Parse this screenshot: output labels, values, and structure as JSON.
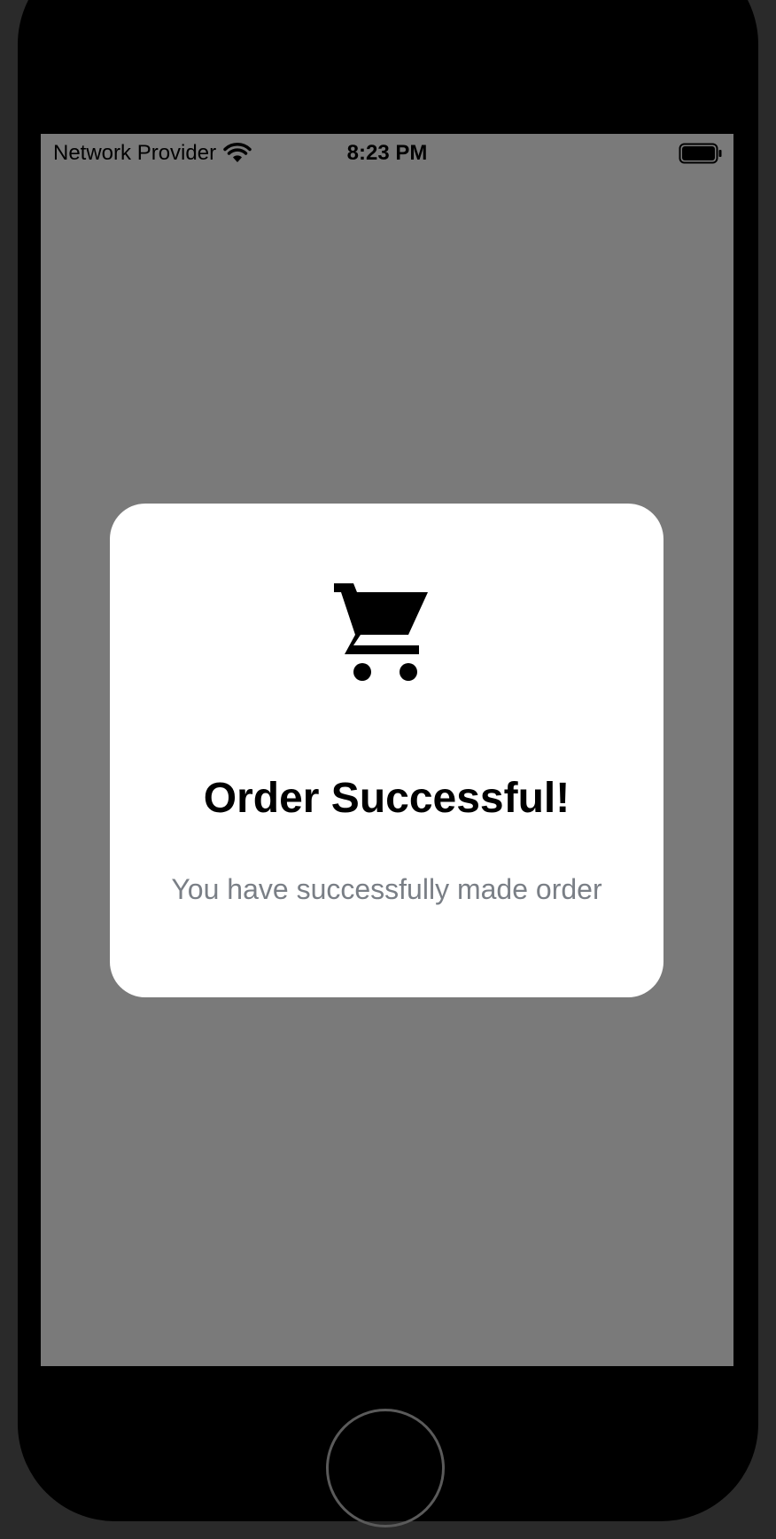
{
  "status_bar": {
    "carrier": "Network Provider",
    "time": "8:23 PM",
    "icons": [
      "wifi-icon",
      "battery-icon"
    ]
  },
  "modal": {
    "icon": "shopping-cart-icon",
    "title": "Order Successful!",
    "message": "You have successfully made order"
  },
  "colors": {
    "overlay": "#7a7a7a",
    "modal_background": "#ffffff",
    "title_text": "#000000",
    "message_text": "#7a7f86",
    "device_frame": "#000000"
  }
}
